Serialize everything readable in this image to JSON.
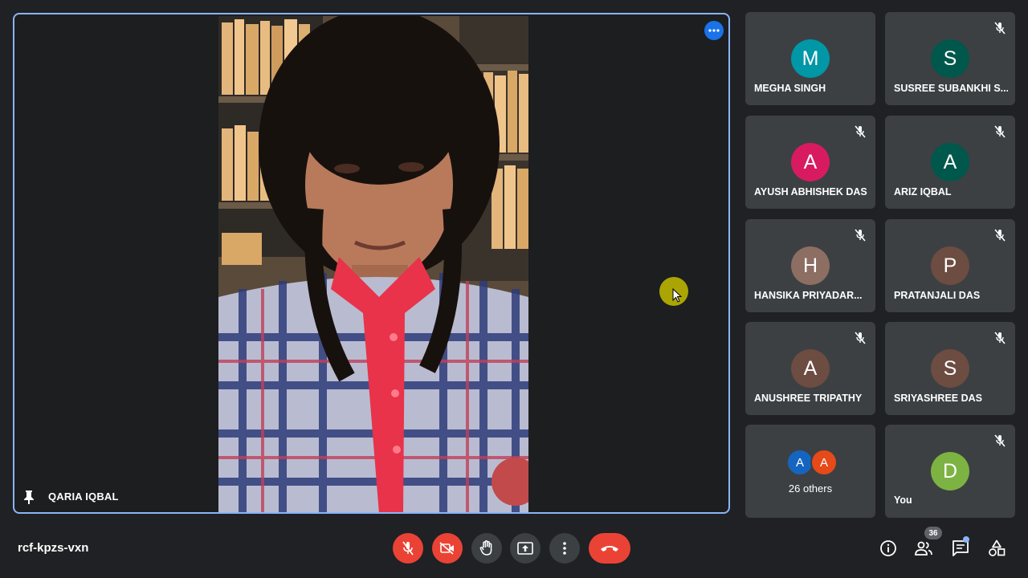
{
  "main": {
    "speaker_name": "QARIA IQBAL",
    "pinned": true
  },
  "participants": [
    {
      "name": "MEGHA SINGH",
      "initial": "M",
      "color": "#0097a7",
      "muted": false
    },
    {
      "name": "SUSREE SUBANKHI S...",
      "initial": "S",
      "color": "#00574b",
      "muted": true
    },
    {
      "name": "AYUSH ABHISHEK DAS",
      "initial": "A",
      "color": "#d81b60",
      "muted": true
    },
    {
      "name": "ARIZ IQBAL",
      "initial": "A",
      "color": "#00574b",
      "muted": true
    },
    {
      "name": "HANSIKA PRIYADAR...",
      "initial": "H",
      "color": "#8d6e63",
      "muted": true
    },
    {
      "name": "PRATANJALI DAS",
      "initial": "P",
      "color": "#6d4c41",
      "muted": true
    },
    {
      "name": "ANUSHREE TRIPATHY",
      "initial": "A",
      "color": "#6d4c41",
      "muted": true
    },
    {
      "name": "SRIYASHREE DAS",
      "initial": "S",
      "color": "#6d4c41",
      "muted": true
    }
  ],
  "others": {
    "label": "26 others",
    "avatars": [
      {
        "initial": "A",
        "color": "#1565c0"
      },
      {
        "initial": "A",
        "color": "#e64a19"
      }
    ]
  },
  "self": {
    "name": "You",
    "initial": "D",
    "color": "#7cb342",
    "muted": true
  },
  "meeting_code": "rcf-kpzs-vxn",
  "people_count": "36"
}
